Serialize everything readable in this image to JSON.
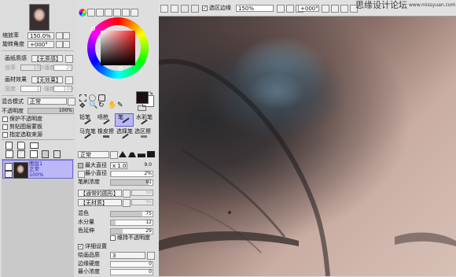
{
  "navigator": {
    "zoom_label": "缩放率",
    "zoom_value": "150.0%",
    "rotate_label": "旋转角度",
    "rotate_value": "+000°"
  },
  "paper": {
    "texture_label": "画纸质感",
    "texture_value": "【无质感】",
    "texture_scale_label": "倍率",
    "texture_scale_value": "100",
    "texture_strength_label": "强度",
    "texture_strength_value": "20",
    "effect_label": "画材效果",
    "effect_value": "【无效果】",
    "effect_width_label": "宽度",
    "effect_width_value": "1",
    "effect_strength_label": "强度",
    "effect_strength_value": "100"
  },
  "layer": {
    "blend_label": "混合模式",
    "blend_value": "正常",
    "opacity_label": "不透明度",
    "opacity_value": "100%",
    "opacity_fraction": 1.0,
    "protect_opacity": "保护不透明度",
    "clipping": "剪贴图层蒙板",
    "selection_source": "指定选取来源",
    "layer_name": "图层1",
    "layer_mode": "正常",
    "layer_opacity": "100%"
  },
  "tools": {
    "row1": [
      "铅笔",
      "喷枪",
      "笔",
      "水彩笔"
    ],
    "row2": [
      "马克笔",
      "橡皮擦",
      "选择笔",
      "选区擦"
    ],
    "colors": {
      "primary": "#1a1010",
      "secondary": "#ffffff",
      "accent": "#8f8fff"
    }
  },
  "brush": {
    "mode_value": "正常",
    "max_size_label": "最大直径",
    "max_size_mult": "x 1.0",
    "max_size_value": "9.0",
    "min_size_label": "最小直径",
    "min_size_value": "2%",
    "min_size_fraction": 0.02,
    "density_label": "笔刷浓度",
    "density_value": "91",
    "density_fraction": 0.91,
    "shape_value": "【通常的圆形】",
    "shape_strength_value": "50",
    "texture_value": "【无材质】",
    "texture_strength_value": "95",
    "blend_label": "混色",
    "blend_value": "75",
    "blend_fraction": 0.75,
    "water_label": "水分量",
    "water_value": "12",
    "water_fraction": 0.12,
    "smear_label": "色延伸",
    "smear_value": "29",
    "smear_fraction": 0.29,
    "keep_opacity": "维持不透明度",
    "detail_settings": "详细设置",
    "quality_label": "绘画品质",
    "quality_value": "3",
    "edge_hardness_label": "边缘硬度",
    "edge_hardness_value": "0",
    "min_density_label": "最小浓度",
    "min_density_value": "0"
  },
  "topbar": {
    "selection_edge_label": "选区边缘",
    "zoom_value": "150%",
    "rotation_value": "+000°"
  },
  "watermark": {
    "line1": "思缘设计论坛",
    "line2": "www.missyuan.com"
  }
}
